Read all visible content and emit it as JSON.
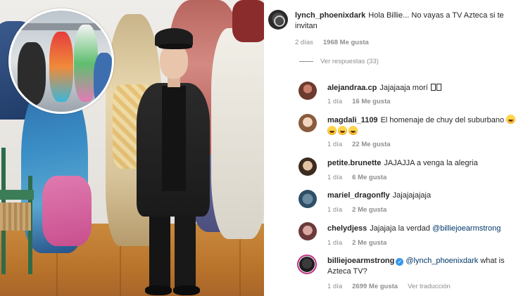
{
  "post": {
    "main_comment": {
      "username": "lynch_phoenixdark",
      "text": "Hola Billie... No vayas a TV Azteca si te invitan",
      "time": "2 días",
      "likes": "1968 Me gusta"
    },
    "view_replies": "Ver respuestas (33)"
  },
  "replies": [
    {
      "username": "alejandraa.cp",
      "text": "Jajajaaja morí",
      "time": "1 día",
      "likes": "16 Me gusta"
    },
    {
      "username": "magdali_1109",
      "text": "El homenaje de chuy del suburbano",
      "time": "1 día",
      "likes": "22 Me gusta"
    },
    {
      "username": "petite.brunette",
      "text": "JAJAJJA a venga la alegria",
      "time": "1 día",
      "likes": "6 Me gusta"
    },
    {
      "username": "mariel_dragonfly",
      "text": "Jajajajajaja",
      "time": "1 día",
      "likes": "2 Me gusta"
    },
    {
      "username": "chelydjess",
      "text": "Jajajaja la verdad",
      "mention": "@billiejoearmstrong",
      "time": "1 día",
      "likes": "2 Me gusta"
    },
    {
      "username": "billiejoearmstrong",
      "mention": "@lynch_phoenixdark",
      "text": "what is Azteca TV?",
      "time": "1 día",
      "likes": "2699 Me gusta",
      "translate": "Ver traducción"
    }
  ]
}
